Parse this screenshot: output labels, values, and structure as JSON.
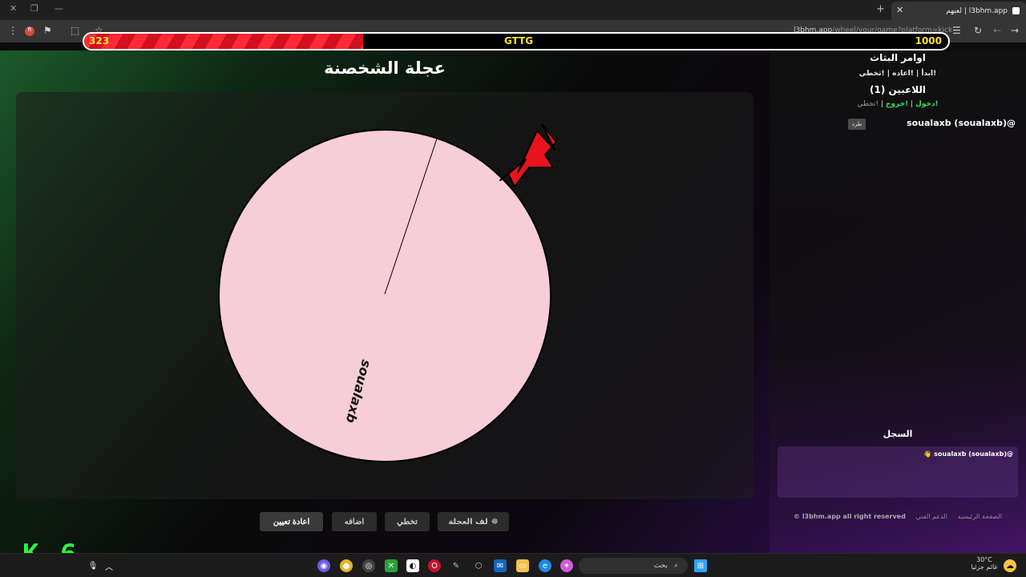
{
  "browser": {
    "tab_title": "لعبهم | l3bhm.app",
    "url_host": "l3bhm.app",
    "url_path": "/wheel/your/game?platform=kick",
    "new_tab": "+",
    "close": "✕"
  },
  "overlay": {
    "health_left": "323",
    "health_center": "GTTG",
    "health_right": "1000",
    "health_fraction": 0.323,
    "watermark": "K 6"
  },
  "main": {
    "title": "عجلة الشخصنة",
    "wheel": {
      "segments": [
        "soualaxb"
      ],
      "segment_color": "#f7cdd8",
      "pointer_color": "#e8131c"
    },
    "buttons": {
      "spin": "لف العجلة",
      "skip": "تخطي",
      "add": "اضافه",
      "reset": "اعادة تعيين"
    }
  },
  "sidebar": {
    "commands_title": "اوامر البثاث",
    "commands_line": "!ابدأ | !اعاده | !تخطي",
    "players_title": "اللاعبين (1)",
    "link_join": "!دخول",
    "link_exit": "!خروج",
    "link_skip": "!تخطي",
    "player_name": "soualaxb (soualaxb)@",
    "kick_label": "طرد",
    "log_title": "السجل",
    "log_entry": "👋 soualaxb (soualaxb)@",
    "footer_home": "الصفحة الرئيسية",
    "footer_support": "الدعم الفني",
    "footer_copy": "l3bhm.app all right reserved ©"
  },
  "taskbar": {
    "search_placeholder": "بحث",
    "weather": "30°C",
    "weather_desc": "غائم جزئيا"
  }
}
